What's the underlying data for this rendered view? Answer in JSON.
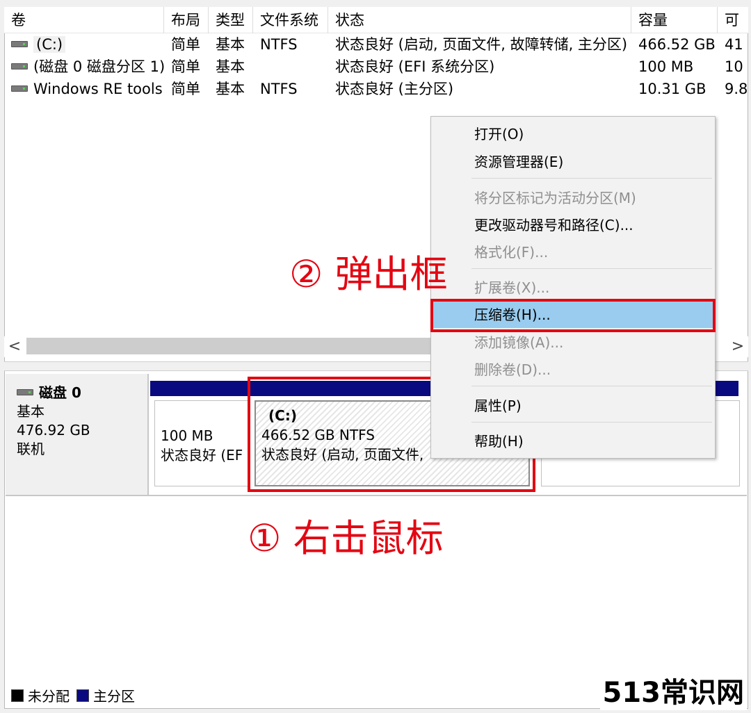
{
  "columns": [
    "卷",
    "布局",
    "类型",
    "文件系统",
    "状态",
    "容量",
    "可"
  ],
  "volumes": [
    {
      "name": "(C:)",
      "layout": "简单",
      "type": "基本",
      "fs": "NTFS",
      "status": "状态良好 (启动, 页面文件, 故障转储, 主分区)",
      "capacity": "466.52 GB",
      "free": "41"
    },
    {
      "name": "(磁盘 0 磁盘分区 1)",
      "layout": "简单",
      "type": "基本",
      "fs": "",
      "status": "状态良好 (EFI 系统分区)",
      "capacity": "100 MB",
      "free": "10"
    },
    {
      "name": "Windows RE tools",
      "layout": "简单",
      "type": "基本",
      "fs": "NTFS",
      "status": "状态良好 (主分区)",
      "capacity": "10.31 GB",
      "free": "9.8"
    }
  ],
  "scroll": {
    "left": "<",
    "right": ">"
  },
  "disk": {
    "name": "磁盘 0",
    "type": "基本",
    "size": "476.92 GB",
    "state": "联机",
    "partitions": [
      {
        "size": "100 MB",
        "status": "状态良好 (EF"
      },
      {
        "name": "(C:)",
        "size": "466.52 GB NTFS",
        "status": "状态良好 (启动, 页面文件,"
      }
    ]
  },
  "context_menu": {
    "items": [
      {
        "label": "打开(O)",
        "enabled": true
      },
      {
        "label": "资源管理器(E)",
        "enabled": true
      },
      {
        "label": "将分区标记为活动分区(M)",
        "enabled": false
      },
      {
        "label": "更改驱动器号和路径(C)...",
        "enabled": true
      },
      {
        "label": "格式化(F)...",
        "enabled": false
      },
      {
        "label": "扩展卷(X)...",
        "enabled": false
      },
      {
        "label": "压缩卷(H)...",
        "enabled": true,
        "highlighted": true
      },
      {
        "label": "添加镜像(A)...",
        "enabled": false
      },
      {
        "label": "删除卷(D)...",
        "enabled": false
      },
      {
        "label": "属性(P)",
        "enabled": true
      },
      {
        "label": "帮助(H)",
        "enabled": true
      }
    ]
  },
  "annotations": {
    "popup": "② 弹出框",
    "right_click": "① 右击鼠标"
  },
  "legend": {
    "unallocated": "未分配",
    "primary": "主分区"
  },
  "watermark": "513常识网",
  "colors": {
    "highlight_red": "#e30613",
    "partition_bar": "#0a0a80",
    "menu_hover": "#99ccee"
  }
}
